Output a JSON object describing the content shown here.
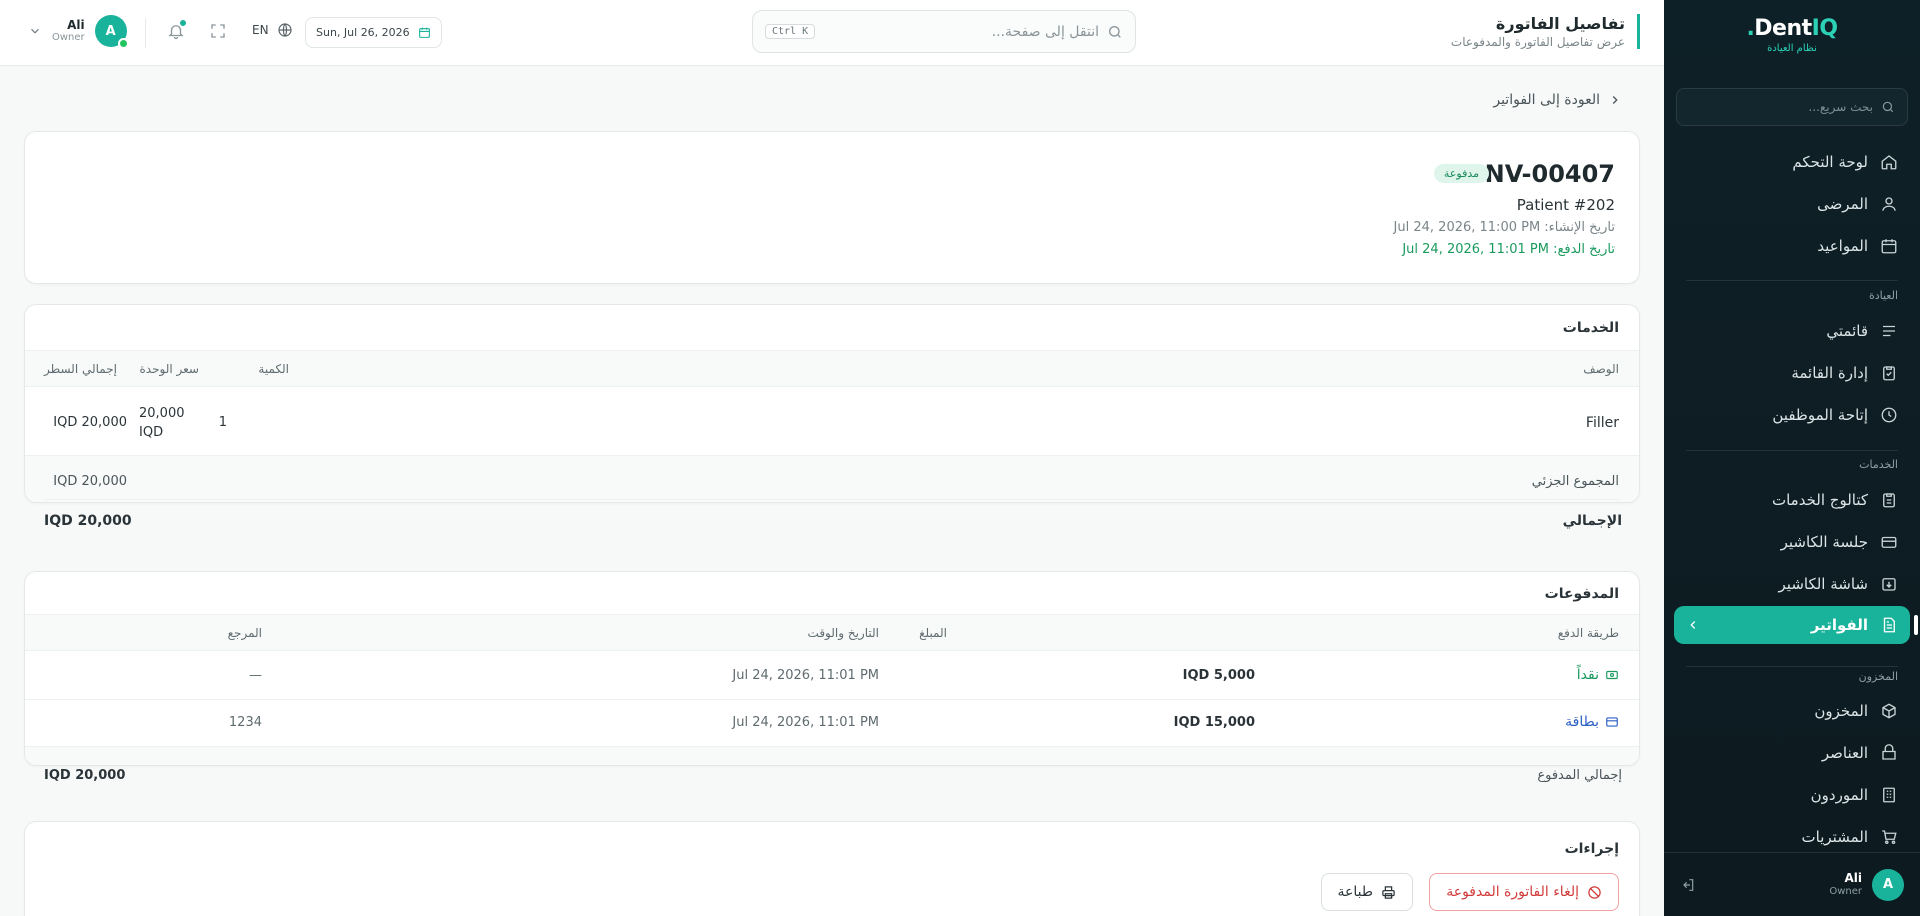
{
  "app": {
    "logo_main": "Dent",
    "logo_accent": "IQ.",
    "logo_sub": "نظام العيادة",
    "quick_search_placeholder": "بحث سريع..."
  },
  "sidebar": {
    "items_top": [
      {
        "label": "لوحة التحكم",
        "icon": "home-icon"
      },
      {
        "label": "المرضى",
        "icon": "users-icon"
      },
      {
        "label": "المواعيد",
        "icon": "calendar-icon"
      }
    ],
    "section_clinic": "العيادة",
    "items_clinic": [
      {
        "label": "قائمتي",
        "icon": "list-icon"
      },
      {
        "label": "إدارة القائمة",
        "icon": "clipboard-icon"
      },
      {
        "label": "إتاحة الموظفين",
        "icon": "clock-icon"
      }
    ],
    "section_services": "الخدمات",
    "items_services": [
      {
        "label": "كتالوج الخدمات",
        "icon": "catalog-icon"
      },
      {
        "label": "جلسة الكاشير",
        "icon": "register-icon"
      },
      {
        "label": "شاشة الكاشير",
        "icon": "cashier-screen-icon"
      },
      {
        "label": "الفواتير",
        "icon": "invoice-icon",
        "active": true
      }
    ],
    "section_inventory": "المخزون",
    "items_inventory": [
      {
        "label": "المخزون",
        "icon": "box-icon"
      },
      {
        "label": "العناصر",
        "icon": "items-icon"
      },
      {
        "label": "الموردون",
        "icon": "building-icon"
      },
      {
        "label": "المشتريات",
        "icon": "cart-icon"
      }
    ],
    "user": {
      "name": "Ali",
      "role": "Owner",
      "initial": "A"
    }
  },
  "header": {
    "title": "تفاصيل الفاتورة",
    "subtitle": "عرض تفاصيل الفاتورة والمدفوعات",
    "search_placeholder": "انتقل إلى صفحة...",
    "shortcut": "Ctrl K",
    "date": "Sun, Jul 26, 2026",
    "lang": "EN",
    "user": {
      "name": "Ali",
      "role": "Owner",
      "initial": "A"
    }
  },
  "invoice": {
    "back_label": "العودة إلى الفواتير",
    "number": "INV-00407",
    "status": "مدفوعة",
    "patient": "Patient #202",
    "created": "تاريخ الإنشاء: Jul 24, 2026, 11:00 PM",
    "paid": "تاريخ الدفع: Jul 24, 2026, 11:01 PM"
  },
  "services": {
    "title": "الخدمات",
    "columns": {
      "description": "الوصف",
      "qty": "الكمية",
      "unit_price": "سعر الوحدة",
      "line_total": "إجمالي السطر"
    },
    "rows": [
      {
        "description": "Filler",
        "qty": "1",
        "unit_price_1": "20,000",
        "unit_price_2": "IQD",
        "line_total": "IQD 20,000"
      }
    ],
    "subtotal_label": "المجموع الجزئي",
    "subtotal": "IQD 20,000",
    "total_label": "الإجمالي",
    "total": "IQD 20,000"
  },
  "payments": {
    "title": "المدفوعات",
    "columns": {
      "method": "طريقة الدفع",
      "amount": "المبلغ",
      "datetime": "التاريخ والوقت",
      "reference": "المرجع"
    },
    "rows": [
      {
        "method": "نقداً",
        "amount": "IQD 5,000",
        "datetime": "Jul 24, 2026, 11:01 PM",
        "reference": "—",
        "color": "#1a9a5e",
        "icon": "cash-icon"
      },
      {
        "method": "بطاقة",
        "amount": "IQD 15,000",
        "datetime": "Jul 24, 2026, 11:01 PM",
        "reference": "1234",
        "color": "#2c5fc4",
        "icon": "card-icon"
      }
    ],
    "total_label": "إجمالي المدفوع",
    "total": "IQD 20,000"
  },
  "actions": {
    "title": "إجراءات",
    "cancel_label": "إلغاء الفاتورة المدفوعة",
    "print_label": "طباعة"
  },
  "colors": {
    "accent": "#19b29a",
    "sidebar_bg": "#0e2027",
    "danger": "#d23b3b",
    "paid_green": "#1a9a5e",
    "card_blue": "#2c5fc4"
  }
}
